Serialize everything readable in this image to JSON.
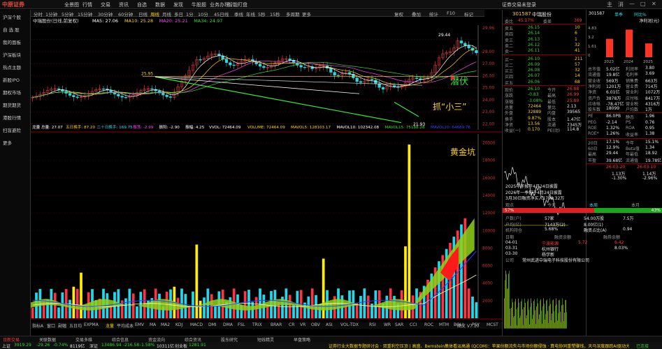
{
  "app": {
    "logo": "中原证券",
    "menu": [
      "全景图",
      "行情",
      "交易",
      "资讯",
      "自选",
      "数据",
      "发现",
      "牛股题",
      "业务办理",
      "智能盯盘"
    ],
    "account": "证券交易未登录",
    "window_icons": [
      "主",
      "消",
      "—",
      "□",
      "✕"
    ]
  },
  "sidebar": {
    "items": [
      "沪深个股",
      "自 选 股",
      "我的面板",
      "沪深板块",
      "热点主题",
      "新股IPO",
      "期权市场",
      "期货期货",
      "港股行情",
      "扫盲避险",
      "更多"
    ]
  },
  "chart_tabs": {
    "items": [
      "分时",
      "1分钟",
      "5分钟",
      "15分钟",
      "30分钟",
      "60分钟",
      "日线",
      "周线",
      "月线",
      "多日",
      "1分",
      "10分",
      "45日线",
      "季线",
      "年线",
      "5秒",
      "15秒",
      "多周期",
      "更多"
    ],
    "active": "周线",
    "right": [
      "复权",
      "叠加",
      "统计",
      "F10",
      "标记"
    ]
  },
  "chart": {
    "stock_title": "中瑞股份(日线,前复权)",
    "ma_legend": [
      {
        "label": "MA5: 27.06",
        "color": "#ffffff"
      },
      {
        "label": "MA10: 25.28",
        "color": "#ffd400"
      },
      {
        "label": "MA20: 25.21",
        "color": "#ff44ff"
      },
      {
        "label": "MA34: 24.97",
        "color": "#33dd33"
      }
    ],
    "y_axis": [
      "29.96",
      "28.00",
      "27.00",
      "26.00",
      "25.00",
      "24.00",
      "23.00",
      "22.00"
    ],
    "price_high": "29.44",
    "price_low": "21.93",
    "price_mark": "25.95",
    "annotations": {
      "qianfu": "潜伏",
      "zhua": "抓“小三”",
      "huangjin": "黄金坑"
    },
    "vol_legend": [
      {
        "label": "龙量 总量: 27.07",
        "color": "#ffffff"
      },
      {
        "label": "五日换手: 87.20",
        "color": "#ffd400"
      },
      {
        "label": "二十日换手: 169.75",
        "color": "#3cd7e6"
      },
      {
        "label": "振荡: -2.99",
        "color": "#ff44ff"
      },
      {
        "label": "振阳: -2.90",
        "color": "#ffffff"
      },
      {
        "label": "振幅: 4.25",
        "color": "#ffffff"
      },
      {
        "label": "VVOL: 72464.09",
        "color": "#ffffff"
      },
      {
        "label": "VOLUME: 72464.09",
        "color": "#ffd400"
      },
      {
        "label": "MAVOL5: 128103.17",
        "color": "#ffd400"
      },
      {
        "label": "MAVOL10: 102342.08",
        "color": "#ffffff"
      },
      {
        "label": "MAVOL15: 75188.28",
        "color": "#33dd33"
      },
      {
        "label": "MAVOL20: 64689.76",
        "color": "#3344ff"
      }
    ],
    "vol_axis": [
      "20000",
      "18000",
      "16000",
      "14000",
      "12000",
      "10000",
      "8000",
      "6000",
      "4000",
      "2000"
    ],
    "vol_label": "成交量"
  },
  "ind_tabs": {
    "items": [
      "指标A",
      "窗口",
      "副幅",
      "五日均",
      "EXPMA",
      "龙量",
      "平均成本",
      "EMV",
      "MA",
      "MA2",
      "KDJ",
      "MACD",
      "DMI",
      "DMA",
      "FSL",
      "TRIX",
      "BRAR",
      "CR",
      "VR",
      "OBV",
      "ASI",
      "VOL-TDX",
      "RSI",
      "WR",
      "SAR",
      "CCI",
      "ROC",
      "MTM",
      "BOLL",
      "PSY",
      "MCST",
      "资金",
      "筹码",
      "估值"
    ],
    "active": "龙量",
    "right": "图文 V7.10"
  },
  "bottom_btns": [
    "日新交易",
    "关联数据",
    "交易多维",
    "综合信息",
    "资金流向",
    "综合资讯",
    "股东研究",
    "短线精灵",
    "早盘策略"
  ],
  "status": {
    "left": "上证",
    "sh_val": "3919.29",
    "sh_chg": "-29.26",
    "sh_pct": "-0.74%",
    "sh_amt": "8119亿",
    "sz": "深证",
    "sz_val": "13486.94",
    "sz_chg": "-216.58",
    "sz_pct": "-1.58%",
    "sz_amt": "10311亿",
    "cyb": "创业板",
    "cyb_val": "1281.91",
    "ticker": "证券行业大数据专题研讨会 · 双重利空压顶 | 高盛、Bernstein集体看淡高通 (QCOM)：苹果份额流失与市场份额侵蚀 · 算电协同重塑赚钱，天马深度跟踪AI驱动大数据服务·",
    "right": "已连接"
  },
  "quote": {
    "code": "301587",
    "name": "中瑞股份",
    "webi_label": "委比",
    "webi_pct": "45.17%",
    "webi_diff_label": "委差",
    "webi_diff": "369",
    "sell": [
      {
        "lvl": "卖五",
        "price": "26.15",
        "vol": "10"
      },
      {
        "lvl": "卖四",
        "price": "26.14",
        "vol": "6"
      },
      {
        "lvl": "卖三",
        "price": "26.13",
        "vol": "1"
      },
      {
        "lvl": "卖二",
        "price": "26.12",
        "vol": "32"
      },
      {
        "lvl": "卖一",
        "price": "26.11",
        "vol": "41"
      }
    ],
    "buy": [
      {
        "lvl": "买一",
        "price": "26.10",
        "vol": "211"
      },
      {
        "lvl": "买二",
        "price": "26.09",
        "vol": "57"
      },
      {
        "lvl": "买三",
        "price": "26.08",
        "vol": "32"
      },
      {
        "lvl": "买四",
        "price": "26.07",
        "vol": "14"
      },
      {
        "lvl": "买五",
        "price": "26.06",
        "vol": "68"
      }
    ],
    "stats": [
      [
        "现价",
        "26.10",
        "今开",
        "26.88"
      ],
      [
        "涨跌",
        "-0.83",
        "最高",
        "26.99"
      ],
      [
        "涨幅",
        "-3.08%",
        "最低",
        "25.89"
      ],
      [
        "总量",
        "72464",
        "量比",
        "2.13"
      ],
      [
        "外盘",
        "32889",
        "内盘",
        "39565"
      ],
      [
        "换手",
        "9.87%",
        "股本",
        "1.47亿"
      ],
      [
        "净资",
        "13.56",
        "流通",
        "7345万"
      ],
      [
        "收益(一)",
        "0.170",
        "PE(动)",
        "114.8"
      ]
    ]
  },
  "f10": {
    "code": "301587",
    "sub": "单季",
    "chg": "同比%",
    "title": "净利润(元)",
    "bars": [
      {
        "label": "2023",
        "h": 0.6
      },
      {
        "label": "2024",
        "h": 0.9
      },
      {
        "label": "2025",
        "h": 0.45
      }
    ],
    "yvals": [
      "4.83",
      "3.2",
      "1.61",
      "0"
    ],
    "rows": [
      [
        "总市值",
        "5.02亿",
        "利润率",
        "3.80"
      ],
      [
        "流通值",
        "19.8亿",
        "毛利率",
        "3.69"
      ],
      [
        "营业收",
        "569万",
        "销售费",
        "663万"
      ],
      [
        "净利润",
        "1201万",
        "营业费",
        "714万"
      ],
      [
        "净资",
        "6.01亿",
        "营业利",
        "1072万"
      ],
      [
        "资产负",
        "3878万",
        "应付帐",
        "8417万"
      ],
      [
        "应收帐",
        "-78.47亿",
        "营业税",
        "4316万"
      ],
      [
        "股东数",
        "18099",
        "户均数",
        "1万"
      ]
    ],
    "rows2": [
      [
        "PE",
        "86.0PB",
        "静态",
        "1.96"
      ],
      [
        "PEG",
        "-2.14",
        "PS",
        "0.76"
      ],
      [
        "ROE",
        "1.32%",
        "ROA",
        "0.95"
      ],
      [
        "ROE*",
        "1.26%",
        "收益率",
        "1.38"
      ]
    ],
    "perf": [
      [
        "20日",
        "17.1%",
        "今年",
        "15.1%"
      ],
      [
        "60日",
        "12.9%",
        "Beta值",
        "1.34"
      ],
      [
        "最高",
        "29.44",
        "年最低",
        "18.92"
      ],
      [
        "市盈",
        "39.68亿",
        "流通值",
        "19.78亿"
      ]
    ],
    "dates": [
      "26-03-20",
      "26-03-10"
    ],
    "nums": [
      "1.13万",
      "1.14万"
    ],
    "pcts": [
      "-1.30%",
      "-2.96%"
    ],
    "notes": [
      "2025年年报于4月24日披露",
      "2026年一季报于4月24日披露",
      "3月30日融资净买入1799.32万"
    ],
    "rating_h": [
      "观点",
      "今天",
      "本周",
      "本月"
    ],
    "bull": "57%",
    "bear": "43%",
    "bull_lab": "看多",
    "bear_lab": "看空",
    "shareholder": [
      [
        "户数(户)",
        "57家",
        "54.00万股",
        "7.5万"
      ],
      [
        "户均(亿)",
        "7143万(2)",
        "8.00亿(1)",
        ""
      ],
      [
        "机构持仓",
        "5.68%",
        "融资占比(A)",
        "0.94"
      ]
    ],
    "rank_h": [
      "日期",
      "融资余额",
      "融券余额"
    ],
    "ranks": [
      [
        "04-01",
        "宁波能源",
        "5.72",
        "6.42"
      ],
      [
        "03-31",
        "杭州银行",
        "",
        "8.03%"
      ],
      [
        "03-30",
        "杨学新",
        "",
        ""
      ]
    ],
    "company": "公司",
    "company_val": "常州武进中瑞电子科技股份有限公司"
  }
}
